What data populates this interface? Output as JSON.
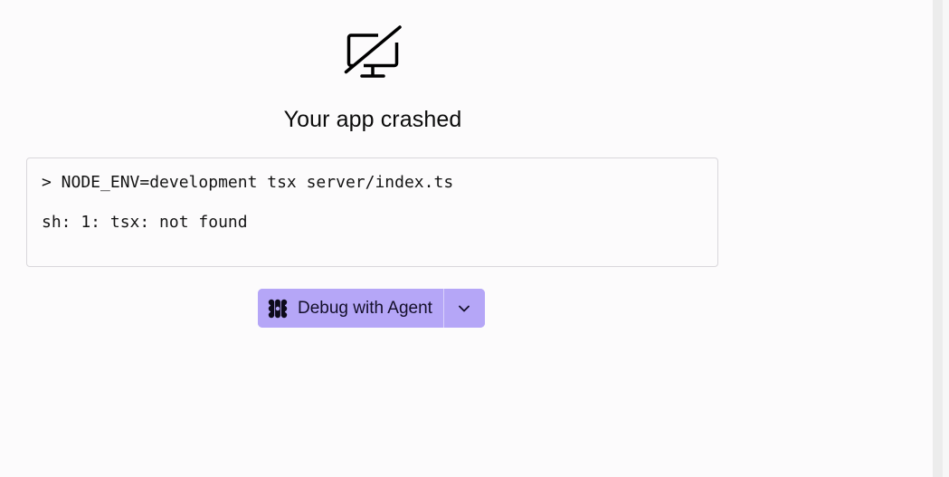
{
  "crash": {
    "title": "Your app crashed",
    "icon": "monitor-off-icon",
    "log_lines": [
      "> NODE_ENV=development tsx server/index.ts",
      "sh: 1: tsx: not found"
    ]
  },
  "actions": {
    "debug_label": "Debug with Agent",
    "debug_icon": "agent-icon",
    "menu_icon": "chevron-down-icon"
  },
  "colors": {
    "background": "#fcfbfc",
    "button_bg": "#b5a6f7",
    "button_text": "#140f2a",
    "border": "#d9d7db"
  }
}
